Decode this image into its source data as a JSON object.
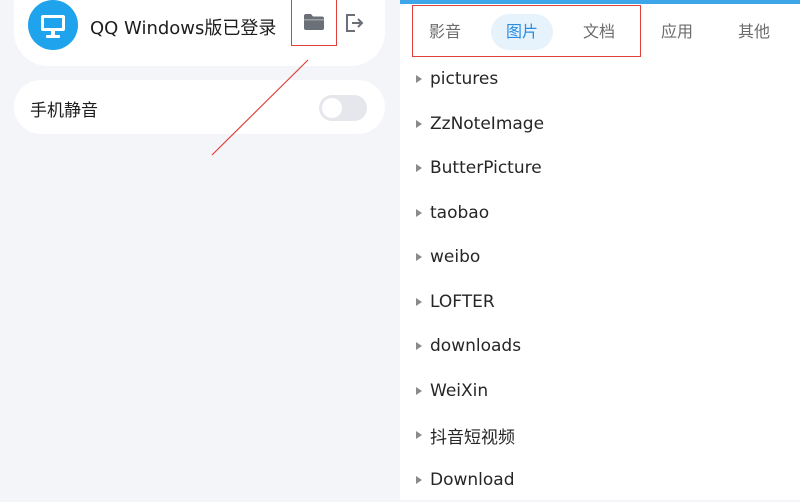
{
  "device_card": {
    "title": "QQ Windows版已登录",
    "avatar_icon": "monitor-icon",
    "folder_icon": "folder-icon",
    "logout_icon": "logout-icon"
  },
  "mute_setting": {
    "label": "手机静音",
    "enabled": false
  },
  "tabs": [
    {
      "label": "影音",
      "active": false
    },
    {
      "label": "图片",
      "active": true
    },
    {
      "label": "文档",
      "active": false
    },
    {
      "label": "应用",
      "active": false
    },
    {
      "label": "其他",
      "active": false
    }
  ],
  "folders": [
    "pictures",
    "ZzNoteImage",
    "ButterPicture",
    "taobao",
    "weibo",
    "LOFTER",
    "downloads",
    "WeiXin",
    "抖音短视频",
    "Download"
  ],
  "colors": {
    "accent_blue": "#2a8de2",
    "avatar_blue": "#1fa3ec",
    "highlight_red": "#e0403a",
    "top_bar": "#3ca6e8"
  }
}
